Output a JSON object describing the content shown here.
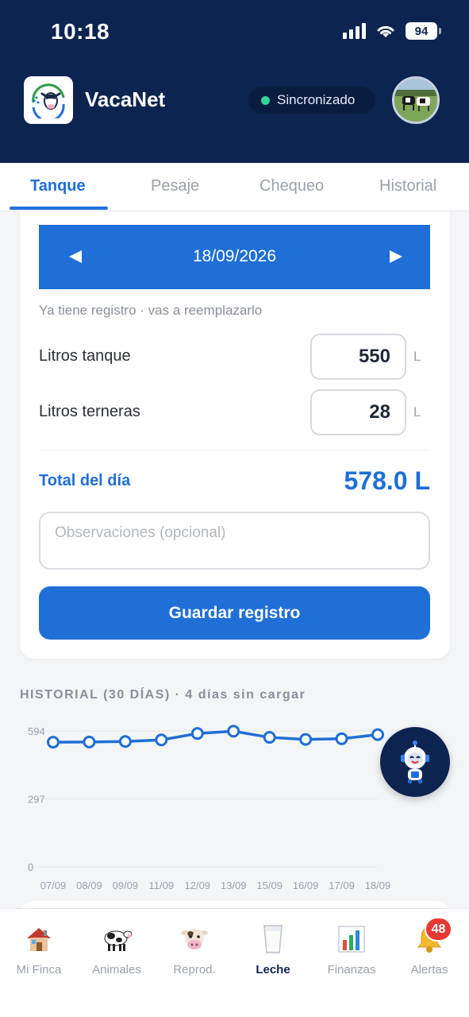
{
  "status_bar": {
    "time": "10:18",
    "battery": "94"
  },
  "header": {
    "app_title": "VacaNet",
    "sync_status": "Sincronizado"
  },
  "tabs": [
    {
      "label": "Tanque",
      "active": true
    },
    {
      "label": "Pesaje",
      "active": false
    },
    {
      "label": "Chequeo",
      "active": false
    },
    {
      "label": "Historial",
      "active": false
    }
  ],
  "form": {
    "date": "18/09/2026",
    "hint": "Ya tiene registro · vas a reemplazarlo",
    "tank_label": "Litros tanque",
    "tank_value": "550",
    "calves_label": "Litros terneras",
    "calves_value": "28",
    "unit": "L",
    "total_label": "Total del día",
    "total_value": "578.0 L",
    "observations_placeholder": "Observaciones (opcional)",
    "save_label": "Guardar registro"
  },
  "history": {
    "title": "HISTORIAL (30 DÍAS) · 4 días sin cargar"
  },
  "chart_data": {
    "type": "line",
    "categories": [
      "07/09",
      "08/09",
      "09/09",
      "11/09",
      "12/09",
      "13/09",
      "15/09",
      "16/09",
      "17/09",
      "18/09"
    ],
    "values": [
      545,
      546,
      548,
      555,
      583,
      593,
      566,
      557,
      560,
      578
    ],
    "y_ticks": [
      "594",
      "297",
      "0"
    ],
    "ylim": [
      0,
      594
    ],
    "grid": true,
    "color": "#1f6fd6"
  },
  "bottom_nav": [
    {
      "label": "Mi Finca",
      "icon": "house-icon",
      "active": false
    },
    {
      "label": "Animales",
      "icon": "cow-icon",
      "active": false
    },
    {
      "label": "Reprod.",
      "icon": "cow-face-icon",
      "active": false
    },
    {
      "label": "Leche",
      "icon": "milk-glass-icon",
      "active": true
    },
    {
      "label": "Finanzas",
      "icon": "bar-chart-icon",
      "active": false
    },
    {
      "label": "Alertas",
      "icon": "bell-icon",
      "active": false
    }
  ],
  "alerts_badge": "48",
  "colors": {
    "primary": "#1f6fd6",
    "header": "#0d2451",
    "success": "#34d399",
    "badge": "#e53935"
  }
}
